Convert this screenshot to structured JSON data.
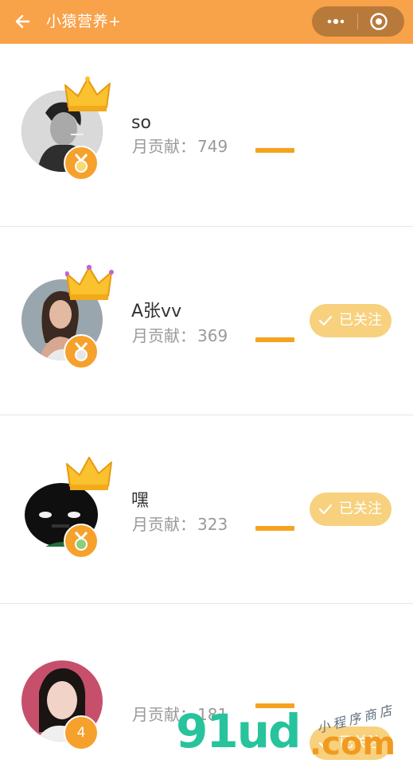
{
  "header": {
    "title": "小猿营养+",
    "back_icon": "arrow-left-icon",
    "more_icon": "more-dots-icon",
    "close_icon": "target-circle-icon",
    "background": "#f8a24a"
  },
  "contribution_label": "月贡献：",
  "follow_label": "已关注",
  "rows": [
    {
      "name": "so",
      "contribution": "749",
      "followed": false,
      "rank_badge": ""
    },
    {
      "name": "A张vv",
      "contribution": "369",
      "followed": true,
      "rank_badge": ""
    },
    {
      "name": "嘿",
      "contribution": "323",
      "followed": true,
      "rank_badge": ""
    },
    {
      "name": "",
      "contribution": "181",
      "followed": true,
      "rank_badge": "4"
    }
  ],
  "watermark": {
    "main": "91ud",
    "domain": ".com",
    "tagline": "小程序商店"
  },
  "colors": {
    "accent": "#f8a24a",
    "bar": "#f5a31f",
    "follow_button": "#f7d17e",
    "medal": "#f6a12c"
  }
}
